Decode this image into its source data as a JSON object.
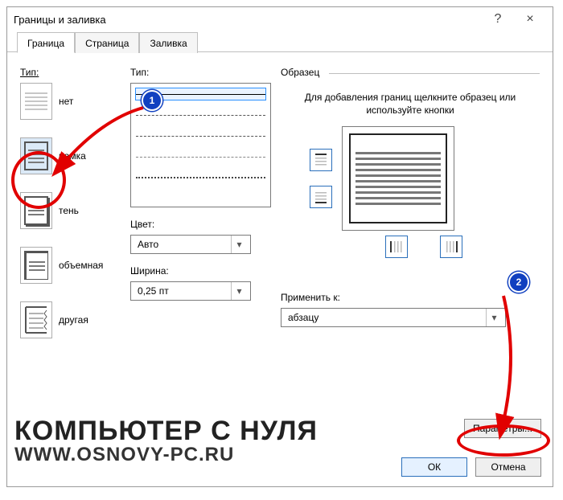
{
  "title": "Границы и заливка",
  "help": "?",
  "close": "×",
  "tabs": {
    "border": "Граница",
    "page": "Страница",
    "fill": "Заливка"
  },
  "type_label": "Тип:",
  "settings": {
    "none": "нет",
    "box": "рамка",
    "shadow": "тень",
    "threeD": "объемная",
    "custom": "другая"
  },
  "style_label": "Тип:",
  "color_label": "Цвет:",
  "color_value": "Авто",
  "width_label": "Ширина:",
  "width_value": "0,25 пт",
  "preview_label": "Образец",
  "hint": "Для добавления границ щелкните образец или используйте кнопки",
  "apply_label": "Применить к:",
  "apply_value": "абзацу",
  "params_btn": "Параметры...",
  "ok": "ОК",
  "cancel": "Отмена",
  "annotations": {
    "badge1": "1",
    "badge2": "2"
  },
  "watermark": {
    "line1": "КОМПЬЮТЕР С НУЛЯ",
    "line2": "WWW.OSNOVY-PC.RU"
  }
}
